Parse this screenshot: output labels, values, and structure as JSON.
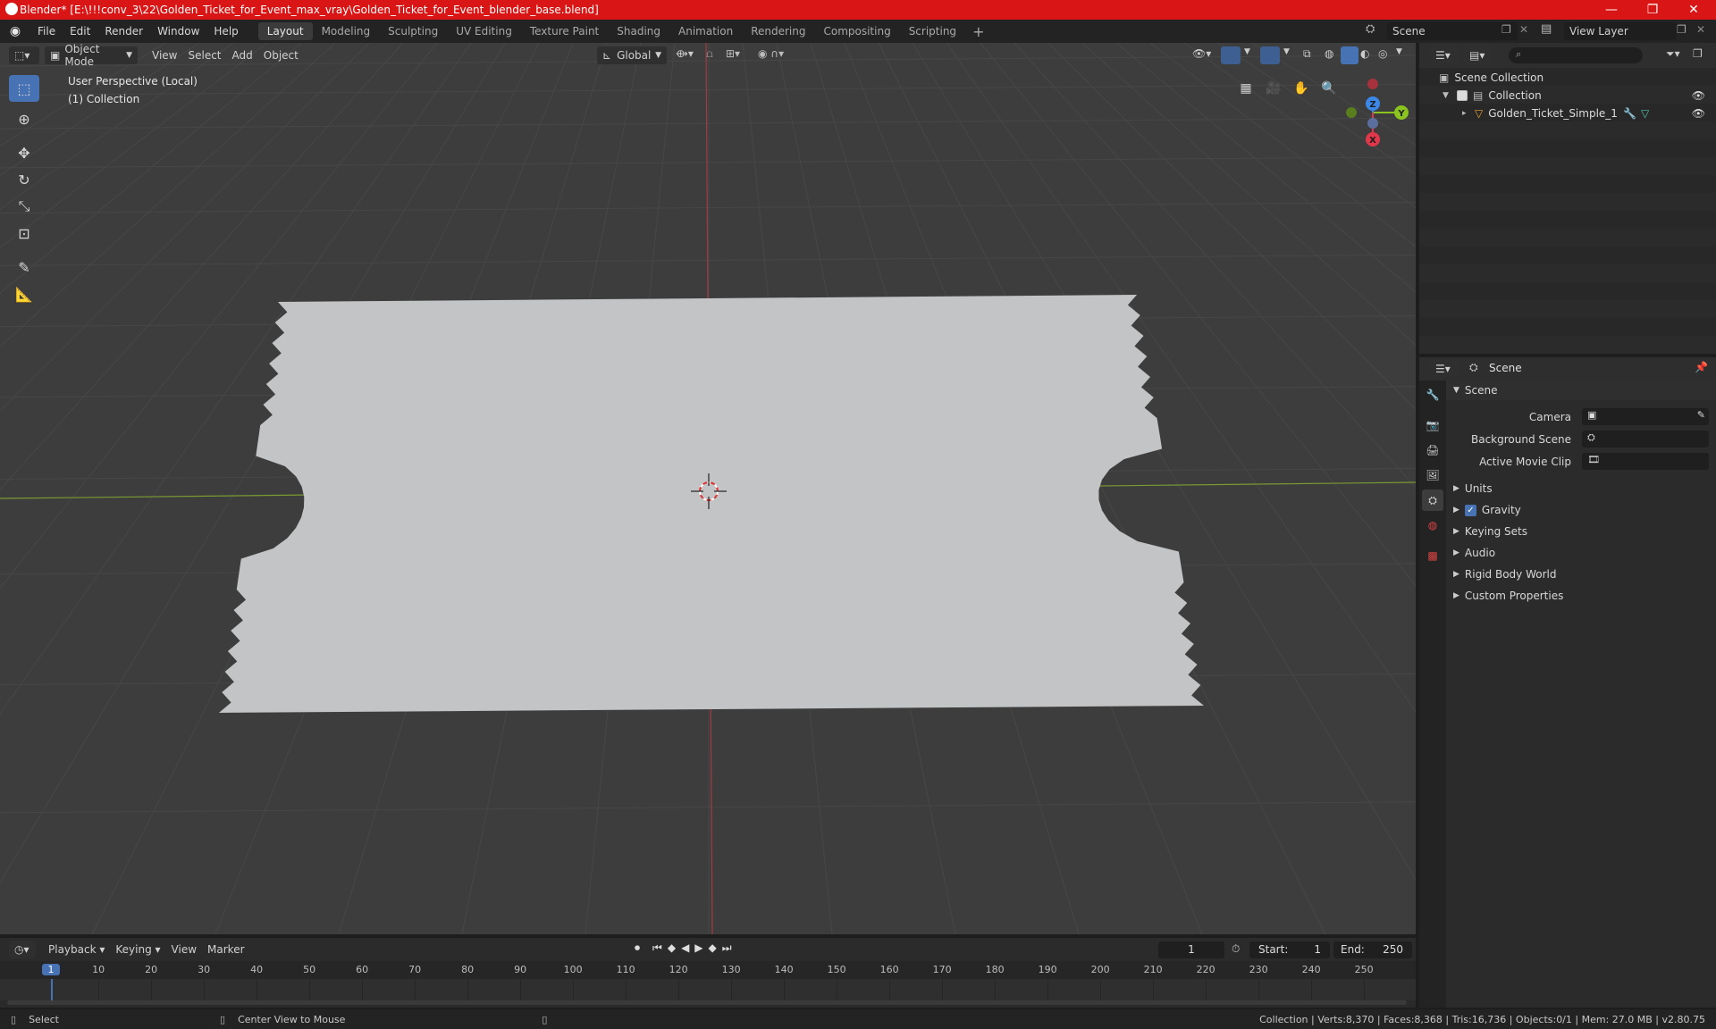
{
  "titlebar": {
    "title": "Blender* [E:\\!!!conv_3\\22\\Golden_Ticket_for_Event_max_vray\\Golden_Ticket_for_Event_blender_base.blend]",
    "minimize": "—",
    "maximize": "❐",
    "close": "✕"
  },
  "menu": [
    "File",
    "Edit",
    "Render",
    "Window",
    "Help"
  ],
  "workspaces": [
    "Layout",
    "Modeling",
    "Sculpting",
    "UV Editing",
    "Texture Paint",
    "Shading",
    "Animation",
    "Rendering",
    "Compositing",
    "Scripting"
  ],
  "active_workspace": "Layout",
  "scene_selector": "Scene",
  "view_layer_selector": "View Layer",
  "viewport": {
    "mode": "Object Mode",
    "menus": [
      "View",
      "Select",
      "Add",
      "Object"
    ],
    "orientation": "Global",
    "overlay_line1": "User Perspective (Local)",
    "overlay_line2": "(1) Collection",
    "gizmo_axes": {
      "x": "X",
      "y": "Y",
      "z": "Z"
    },
    "colors": {
      "x_axis": "#e0374b",
      "y_axis": "#8bc31f",
      "z_axis": "#3b88e8",
      "ticket": "#c2c4c5",
      "bg": "#3d3d3d",
      "grid": "#4a4a4a"
    }
  },
  "outliner": {
    "root": "Scene Collection",
    "collection": "Collection",
    "object": "Golden_Ticket_Simple_1"
  },
  "properties": {
    "header": "Scene",
    "section": "Scene",
    "fields": [
      {
        "label": "Camera",
        "value": ""
      },
      {
        "label": "Background Scene",
        "value": ""
      },
      {
        "label": "Active Movie Clip",
        "value": ""
      }
    ],
    "panels": [
      "Units",
      "Gravity",
      "Keying Sets",
      "Audio",
      "Rigid Body World",
      "Custom Properties"
    ],
    "gravity_checked": true
  },
  "timeline": {
    "menus": [
      "Playback",
      "Keying",
      "View",
      "Marker"
    ],
    "current_frame": "1",
    "start_label": "Start:",
    "start": "1",
    "end_label": "End:",
    "end": "250",
    "ticks": [
      "1",
      "10",
      "20",
      "30",
      "40",
      "50",
      "60",
      "70",
      "80",
      "90",
      "100",
      "110",
      "120",
      "130",
      "140",
      "150",
      "160",
      "170",
      "180",
      "190",
      "200",
      "210",
      "220",
      "230",
      "240",
      "250"
    ]
  },
  "statusbar": {
    "left": "Select",
    "middle": "Center View to Mouse",
    "right": "Collection | Verts:8,370 | Faces:8,368 | Tris:16,736 | Objects:0/1 | Mem: 27.0 MB | v2.80.75"
  }
}
